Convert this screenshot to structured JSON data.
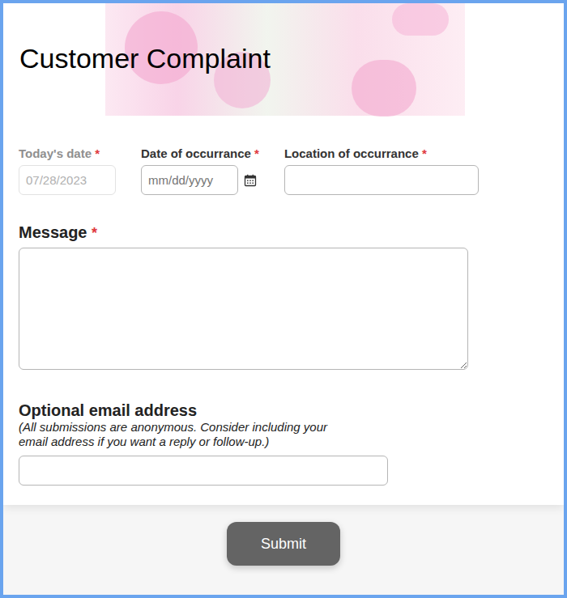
{
  "form": {
    "title": "Customer Complaint",
    "fields": [
      {
        "label": "Today's date",
        "marker": "*",
        "disabled": true,
        "kind": "date",
        "value": "07/28/2023"
      },
      {
        "label": "Date of occurrance",
        "marker": "*",
        "disabled": false,
        "kind": "date-picker",
        "placeholder": "mm/dd/yyyy"
      },
      {
        "label": "Location of occurrance",
        "marker": "*",
        "disabled": false,
        "kind": "text"
      }
    ],
    "message": {
      "label": "Message",
      "marker": "*"
    },
    "email": {
      "label": "Optional email address",
      "note": "(All submissions are anonymous. Consider including your email address if you want a reply or follow-up.)"
    },
    "submit": {
      "label": "Submit"
    }
  }
}
